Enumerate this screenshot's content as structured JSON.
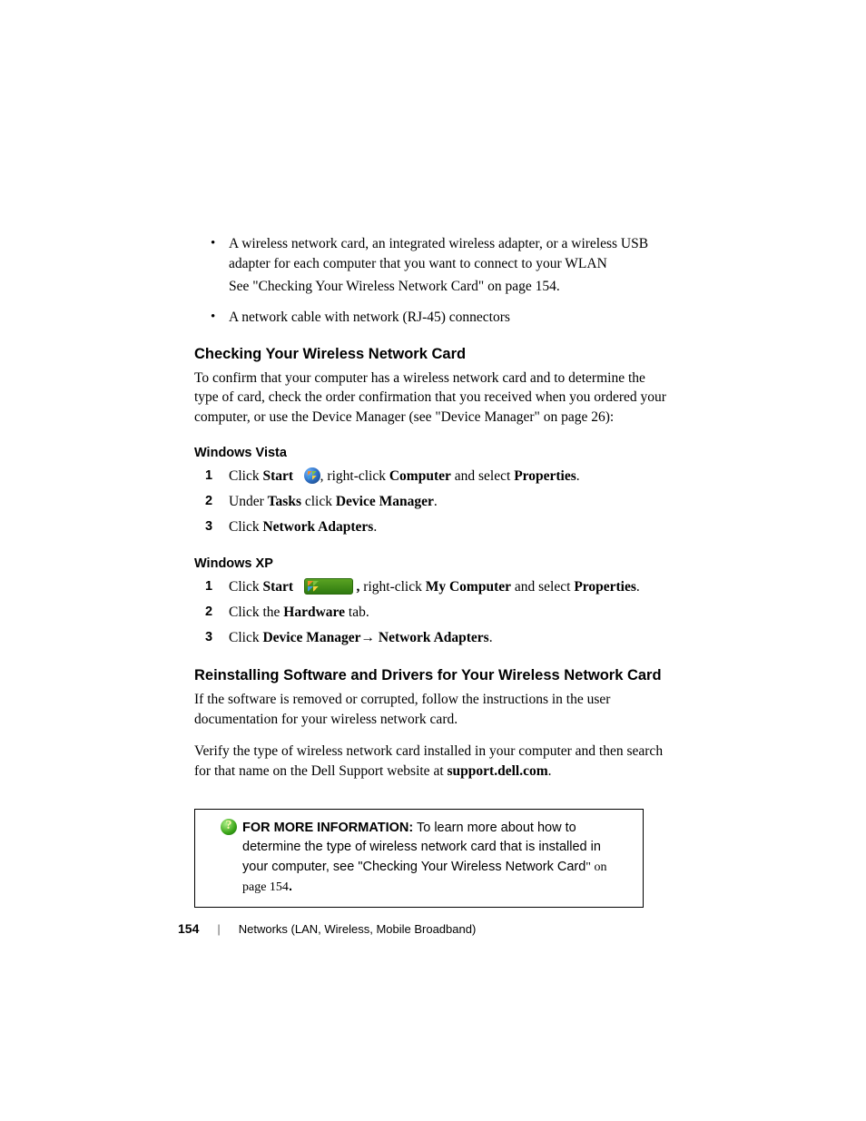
{
  "bullets": {
    "b1_line1": "A wireless network card, an integrated wireless adapter, or a wireless USB",
    "b1_line2": "adapter for each computer that you want to connect to your WLAN",
    "b1_see": "See \"Checking Your Wireless Network Card\" on page 154.",
    "b2": "A network cable with network (RJ-45) connectors"
  },
  "h_check": "Checking Your Wireless Network Card",
  "p_check": "To confirm that your computer has a wireless network card and to determine the type of card, check the order confirmation that you received when you ordered your computer, or use the Device Manager (see \"Device Manager\" on page 26):",
  "h_vista": "Windows Vista",
  "vista": {
    "s1_a": "Click ",
    "s1_start": "Start",
    "s1_b": ", right-click ",
    "s1_computer": "Computer",
    "s1_c": " and select ",
    "s1_properties": "Properties",
    "s1_d": ".",
    "s2_a": "Under ",
    "s2_tasks": "Tasks",
    "s2_b": " click ",
    "s2_dm": "Device Manager",
    "s2_c": ".",
    "s3_a": "Click ",
    "s3_na": "Network Adapters",
    "s3_b": "."
  },
  "h_xp": "Windows XP",
  "xp": {
    "s1_a": "Click ",
    "s1_start": "Start",
    "s1_b": " right-click ",
    "s1_mycomp": "My Computer",
    "s1_c": " and select ",
    "s1_properties": "Properties",
    "s1_d": ".",
    "s1_comma": ",",
    "s2_a": "Click the ",
    "s2_hw": "Hardware",
    "s2_b": " tab.",
    "s3_a": "Click ",
    "s3_dm": "Device Manager",
    "s3_arrow": "→ ",
    "s3_na": "Network Adapters",
    "s3_b": "."
  },
  "h_reinstall": "Reinstalling Software and Drivers for Your Wireless Network Card",
  "p_reinstall1": "If the software is removed or corrupted, follow the instructions in the user documentation for your wireless network card.",
  "p_reinstall2_a": "Verify the type of wireless network card installed in your computer and then search for that name on the Dell Support website at ",
  "p_reinstall2_b": "support.dell.com",
  "p_reinstall2_c": ".",
  "info": {
    "label": "FOR MORE INFORMATION:",
    "text_a": " To learn more about how to determine the type of wireless network card that is installed in your computer, see \"Checking Your Wireless Network Card",
    "text_b": "\" on page 154",
    "text_c": "."
  },
  "footer": {
    "page": "154",
    "sep": "|",
    "chapter": "Networks (LAN, Wireless, Mobile Broadband)"
  }
}
